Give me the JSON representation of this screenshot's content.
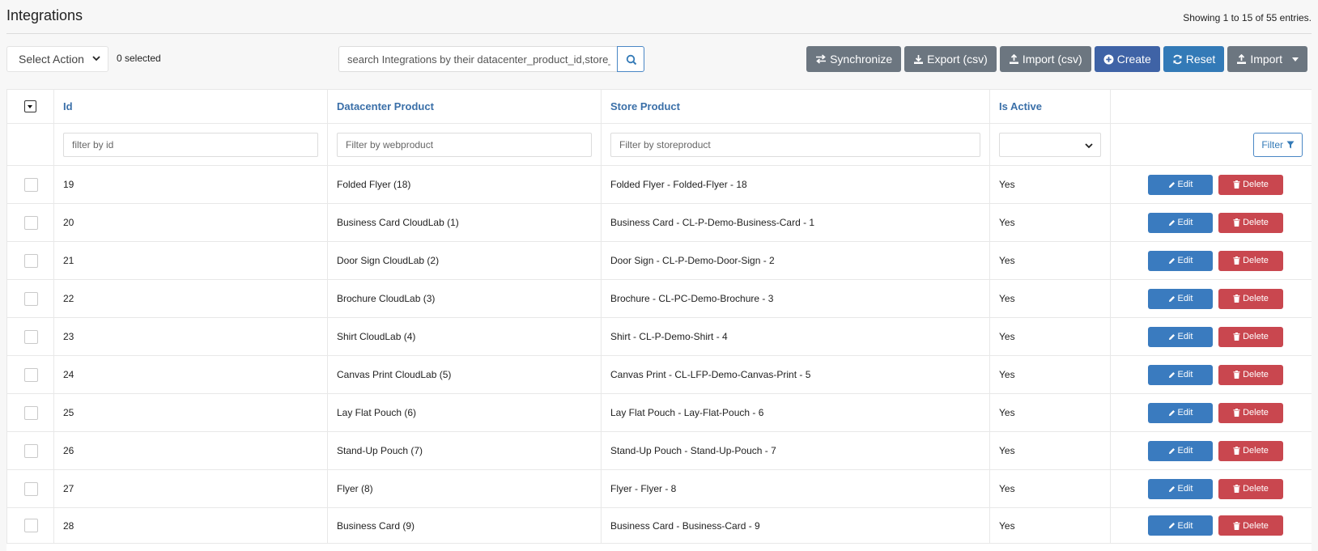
{
  "header": {
    "title": "Integrations",
    "entries_info": "Showing 1 to 15 of 55 entries."
  },
  "toolbar": {
    "select_action": "Select Action",
    "selected_count": "0 selected",
    "search_placeholder": "search Integrations by their datacenter_product_id,store_product_id",
    "buttons": {
      "synchronize": "Synchronize",
      "export_csv": "Export (csv)",
      "import_csv": "Import (csv)",
      "create": "Create",
      "reset": "Reset",
      "import": "Import"
    }
  },
  "table": {
    "columns": {
      "id": "Id",
      "datacenter_product": "Datacenter Product",
      "store_product": "Store Product",
      "is_active": "Is Active"
    },
    "filters": {
      "id_placeholder": "filter by id",
      "datacenter_placeholder": "Filter by webproduct",
      "store_placeholder": "Filter by storeproduct",
      "is_active_value": "",
      "filter_button": "Filter"
    },
    "row_actions": {
      "edit": "Edit",
      "delete": "Delete"
    },
    "rows": [
      {
        "id": "19",
        "datacenter_product": "Folded Flyer (18)",
        "store_product": "Folded Flyer - Folded-Flyer - 18",
        "is_active": "Yes"
      },
      {
        "id": "20",
        "datacenter_product": "Business Card CloudLab (1)",
        "store_product": "Business Card - CL-P-Demo-Business-Card - 1",
        "is_active": "Yes"
      },
      {
        "id": "21",
        "datacenter_product": "Door Sign CloudLab (2)",
        "store_product": "Door Sign - CL-P-Demo-Door-Sign - 2",
        "is_active": "Yes"
      },
      {
        "id": "22",
        "datacenter_product": "Brochure CloudLab (3)",
        "store_product": "Brochure - CL-PC-Demo-Brochure - 3",
        "is_active": "Yes"
      },
      {
        "id": "23",
        "datacenter_product": "Shirt CloudLab (4)",
        "store_product": "Shirt - CL-P-Demo-Shirt - 4",
        "is_active": "Yes"
      },
      {
        "id": "24",
        "datacenter_product": "Canvas Print CloudLab (5)",
        "store_product": "Canvas Print - CL-LFP-Demo-Canvas-Print - 5",
        "is_active": "Yes"
      },
      {
        "id": "25",
        "datacenter_product": "Lay Flat Pouch (6)",
        "store_product": "Lay Flat Pouch - Lay-Flat-Pouch - 6",
        "is_active": "Yes"
      },
      {
        "id": "26",
        "datacenter_product": "Stand-Up Pouch (7)",
        "store_product": "Stand-Up Pouch - Stand-Up-Pouch - 7",
        "is_active": "Yes"
      },
      {
        "id": "27",
        "datacenter_product": "Flyer (8)",
        "store_product": "Flyer - Flyer - 8",
        "is_active": "Yes"
      },
      {
        "id": "28",
        "datacenter_product": "Business Card (9)",
        "store_product": "Business Card - Business-Card - 9",
        "is_active": "Yes"
      }
    ]
  },
  "colors": {
    "link_blue": "#3a6fa8",
    "primary": "#337ab7",
    "navy": "#3f63a6",
    "gray": "#6c7680",
    "danger": "#c9474f"
  }
}
